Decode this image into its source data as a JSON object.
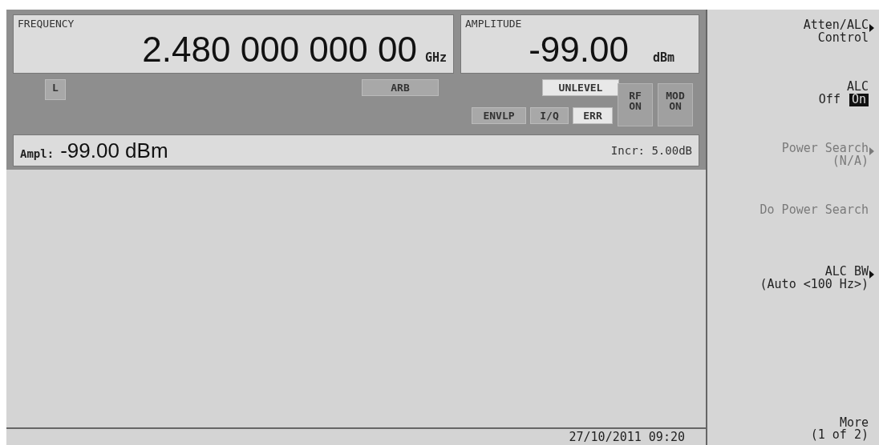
{
  "frequency": {
    "label": "FREQUENCY",
    "value": "2.480 000 000 00",
    "unit": "GHz"
  },
  "amplitude": {
    "label": "AMPLITUDE",
    "value": "-99.00",
    "unit": "dBm"
  },
  "annunciators": {
    "left": [
      {
        "text": "L",
        "lit": false
      }
    ],
    "center": [
      {
        "text": "ARB",
        "lit": false
      }
    ],
    "upper": [
      {
        "text": "UNLEVEL",
        "lit": true
      }
    ],
    "lower": [
      {
        "text": "ENVLP",
        "lit": false
      },
      {
        "text": "I/Q",
        "lit": false
      },
      {
        "text": "ERR",
        "lit": true
      }
    ]
  },
  "rf": {
    "lines": [
      "RF",
      "ON"
    ]
  },
  "mod": {
    "lines": [
      "MOD",
      "ON"
    ]
  },
  "entry": {
    "label": "Ampl:",
    "value": "-99.00 dBm",
    "increment": "Incr: 5.00dB"
  },
  "status_bar": {
    "datetime": "27/10/2011 09:20"
  },
  "softkeys": [
    {
      "kind": "menu",
      "lines": [
        "Atten/ALC",
        "Control"
      ],
      "disabled": false
    },
    {
      "kind": "toggle",
      "lines": [
        "ALC"
      ],
      "options": [
        {
          "label": "Off",
          "selected": false
        },
        {
          "label": "On",
          "selected": true
        }
      ],
      "disabled": false
    },
    {
      "kind": "menu",
      "lines": [
        "Power Search",
        "(N/A)"
      ],
      "disabled": true
    },
    {
      "kind": "action",
      "lines": [
        "Do Power Search"
      ],
      "disabled": true
    },
    {
      "kind": "menu",
      "lines": [
        "ALC BW",
        "(Auto <100 Hz>)"
      ],
      "disabled": false
    }
  ],
  "more_key": {
    "lines": [
      "More",
      "(1 of 2)"
    ]
  }
}
